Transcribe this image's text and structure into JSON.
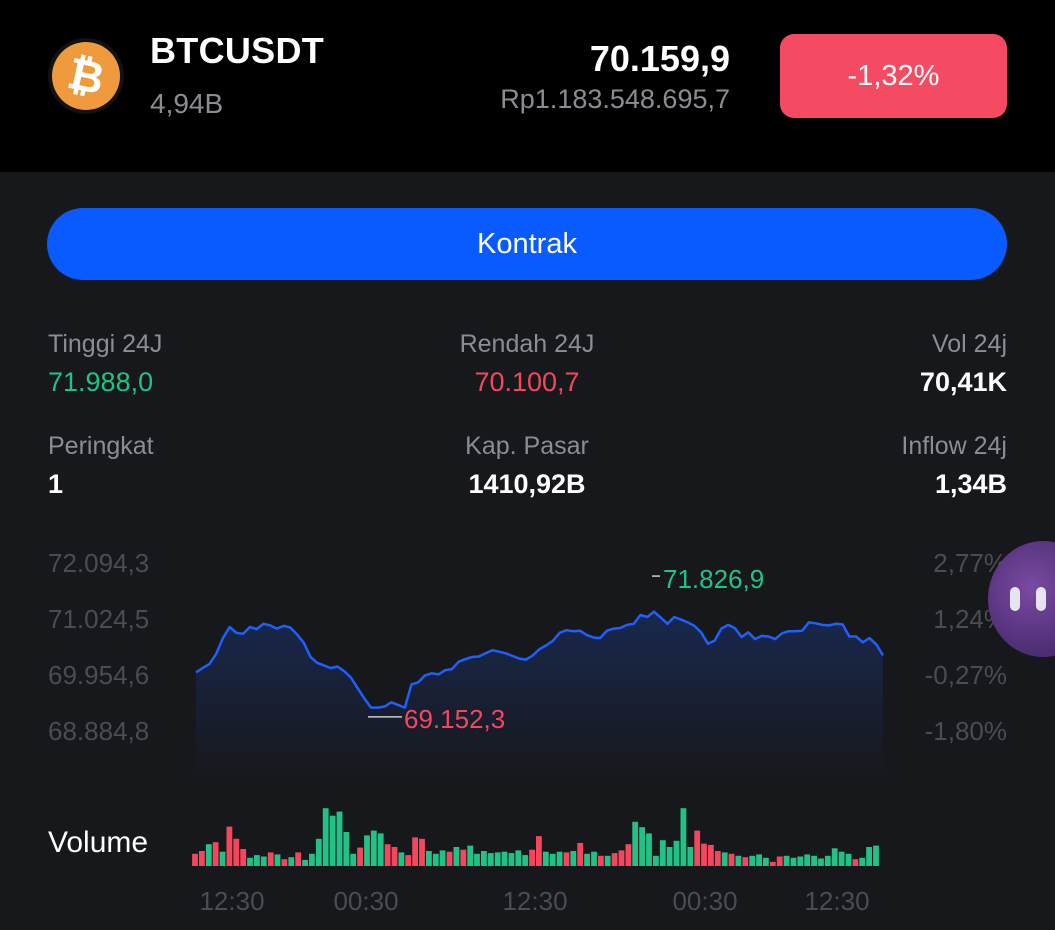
{
  "header": {
    "symbol": "BTCUSDT",
    "volume": "4,94B",
    "price": "70.159,9",
    "price_idr": "Rp1.183.548.695,7",
    "change": "-1,32%",
    "coin_icon": "bitcoin-icon",
    "coin_glyph": "₿"
  },
  "actions": {
    "kontrak_label": "Kontrak"
  },
  "stats": {
    "high_label": "Tinggi 24J",
    "high_value": "71.988,0",
    "low_label": "Rendah 24J",
    "low_value": "70.100,7",
    "vol_label": "Vol 24j",
    "vol_value": "70,41K",
    "rank_label": "Peringkat",
    "rank_value": "1",
    "mcap_label": "Kap. Pasar",
    "mcap_value": "1410,92B",
    "inflow_label": "Inflow 24j",
    "inflow_value": "1,34B"
  },
  "colors": {
    "up": "#22c286",
    "down": "#f5465e",
    "line": "#1f5fff",
    "accent": "#0a5bff"
  },
  "chart_data": {
    "type": "line",
    "price_axis": [
      "72.094,3",
      "71.024,5",
      "69.954,6",
      "68.884,8"
    ],
    "percent_axis": [
      "2,77%",
      "1,24%",
      "-0,27%",
      "-1,80%"
    ],
    "ylim": [
      68884.8,
      72094.3
    ],
    "max_label": "71.826,9",
    "max_value": 71826.9,
    "min_label": "69.152,3",
    "min_value": 69152.3,
    "x_labels": [
      "12:30",
      "00:30",
      "12:30",
      "00:30",
      "12:30"
    ],
    "price_series": [
      70000,
      70080,
      70160,
      70350,
      70650,
      70860,
      70750,
      70730,
      70860,
      70820,
      70920,
      70890,
      70830,
      70880,
      70850,
      70720,
      70560,
      70290,
      70180,
      70130,
      70080,
      70110,
      70020,
      69900,
      69700,
      69500,
      69330,
      69330,
      69350,
      69430,
      69380,
      69330,
      69770,
      69810,
      69940,
      69980,
      69960,
      70040,
      70060,
      70200,
      70250,
      70290,
      70300,
      70360,
      70420,
      70390,
      70360,
      70310,
      70260,
      70240,
      70320,
      70440,
      70510,
      70600,
      70750,
      70800,
      70780,
      70790,
      70710,
      70660,
      70650,
      70790,
      70830,
      70840,
      70900,
      70920,
      71090,
      71050,
      71150,
      71040,
      70920,
      71050,
      71000,
      70950,
      70880,
      70760,
      70540,
      70600,
      70830,
      70900,
      70840,
      70670,
      70760,
      70630,
      70690,
      70680,
      70630,
      70740,
      70780,
      70780,
      70790,
      70950,
      70930,
      70900,
      70890,
      70920,
      70910,
      70680,
      70680,
      70570,
      70650,
      70530,
      70320
    ],
    "volume_label": "Volume",
    "volume_bars": [
      {
        "v": 0.18,
        "up": false
      },
      {
        "v": 0.22,
        "up": false
      },
      {
        "v": 0.32,
        "up": true
      },
      {
        "v": 0.35,
        "up": false
      },
      {
        "v": 0.21,
        "up": true
      },
      {
        "v": 0.58,
        "up": false
      },
      {
        "v": 0.4,
        "up": false
      },
      {
        "v": 0.25,
        "up": false
      },
      {
        "v": 0.12,
        "up": true
      },
      {
        "v": 0.16,
        "up": true
      },
      {
        "v": 0.14,
        "up": true
      },
      {
        "v": 0.2,
        "up": false
      },
      {
        "v": 0.17,
        "up": true
      },
      {
        "v": 0.1,
        "up": false
      },
      {
        "v": 0.13,
        "up": true
      },
      {
        "v": 0.2,
        "up": false
      },
      {
        "v": 0.09,
        "up": true
      },
      {
        "v": 0.18,
        "up": true
      },
      {
        "v": 0.4,
        "up": true
      },
      {
        "v": 0.85,
        "up": true
      },
      {
        "v": 0.74,
        "up": true
      },
      {
        "v": 0.8,
        "up": true
      },
      {
        "v": 0.5,
        "up": true
      },
      {
        "v": 0.18,
        "up": true
      },
      {
        "v": 0.27,
        "up": false
      },
      {
        "v": 0.45,
        "up": true
      },
      {
        "v": 0.52,
        "up": true
      },
      {
        "v": 0.48,
        "up": true
      },
      {
        "v": 0.32,
        "up": false
      },
      {
        "v": 0.28,
        "up": false
      },
      {
        "v": 0.2,
        "up": true
      },
      {
        "v": 0.16,
        "up": false
      },
      {
        "v": 0.42,
        "up": false
      },
      {
        "v": 0.4,
        "up": false
      },
      {
        "v": 0.22,
        "up": true
      },
      {
        "v": 0.18,
        "up": true
      },
      {
        "v": 0.23,
        "up": true
      },
      {
        "v": 0.21,
        "up": false
      },
      {
        "v": 0.28,
        "up": true
      },
      {
        "v": 0.24,
        "up": false
      },
      {
        "v": 0.3,
        "up": true
      },
      {
        "v": 0.18,
        "up": true
      },
      {
        "v": 0.22,
        "up": true
      },
      {
        "v": 0.19,
        "up": true
      },
      {
        "v": 0.2,
        "up": true
      },
      {
        "v": 0.21,
        "up": true
      },
      {
        "v": 0.19,
        "up": true
      },
      {
        "v": 0.23,
        "up": true
      },
      {
        "v": 0.16,
        "up": true
      },
      {
        "v": 0.24,
        "up": false
      },
      {
        "v": 0.44,
        "up": false
      },
      {
        "v": 0.21,
        "up": true
      },
      {
        "v": 0.18,
        "up": true
      },
      {
        "v": 0.21,
        "up": true
      },
      {
        "v": 0.2,
        "up": false
      },
      {
        "v": 0.22,
        "up": true
      },
      {
        "v": 0.34,
        "up": false
      },
      {
        "v": 0.18,
        "up": true
      },
      {
        "v": 0.21,
        "up": true
      },
      {
        "v": 0.15,
        "up": false
      },
      {
        "v": 0.15,
        "up": true
      },
      {
        "v": 0.19,
        "up": false
      },
      {
        "v": 0.23,
        "up": false
      },
      {
        "v": 0.32,
        "up": false
      },
      {
        "v": 0.65,
        "up": true
      },
      {
        "v": 0.57,
        "up": true
      },
      {
        "v": 0.48,
        "up": true
      },
      {
        "v": 0.15,
        "up": true
      },
      {
        "v": 0.38,
        "up": true
      },
      {
        "v": 0.28,
        "up": true
      },
      {
        "v": 0.37,
        "up": true
      },
      {
        "v": 0.85,
        "up": true
      },
      {
        "v": 0.28,
        "up": true
      },
      {
        "v": 0.52,
        "up": false
      },
      {
        "v": 0.33,
        "up": false
      },
      {
        "v": 0.31,
        "up": false
      },
      {
        "v": 0.22,
        "up": false
      },
      {
        "v": 0.2,
        "up": true
      },
      {
        "v": 0.18,
        "up": false
      },
      {
        "v": 0.15,
        "up": true
      },
      {
        "v": 0.13,
        "up": false
      },
      {
        "v": 0.15,
        "up": true
      },
      {
        "v": 0.17,
        "up": true
      },
      {
        "v": 0.12,
        "up": true
      },
      {
        "v": 0.06,
        "up": false
      },
      {
        "v": 0.14,
        "up": false
      },
      {
        "v": 0.15,
        "up": true
      },
      {
        "v": 0.12,
        "up": true
      },
      {
        "v": 0.14,
        "up": true
      },
      {
        "v": 0.17,
        "up": true
      },
      {
        "v": 0.15,
        "up": true
      },
      {
        "v": 0.11,
        "up": true
      },
      {
        "v": 0.15,
        "up": true
      },
      {
        "v": 0.26,
        "up": true
      },
      {
        "v": 0.21,
        "up": true
      },
      {
        "v": 0.18,
        "up": true
      },
      {
        "v": 0.1,
        "up": false
      },
      {
        "v": 0.12,
        "up": true
      },
      {
        "v": 0.28,
        "up": true
      },
      {
        "v": 0.3,
        "up": true
      }
    ]
  }
}
